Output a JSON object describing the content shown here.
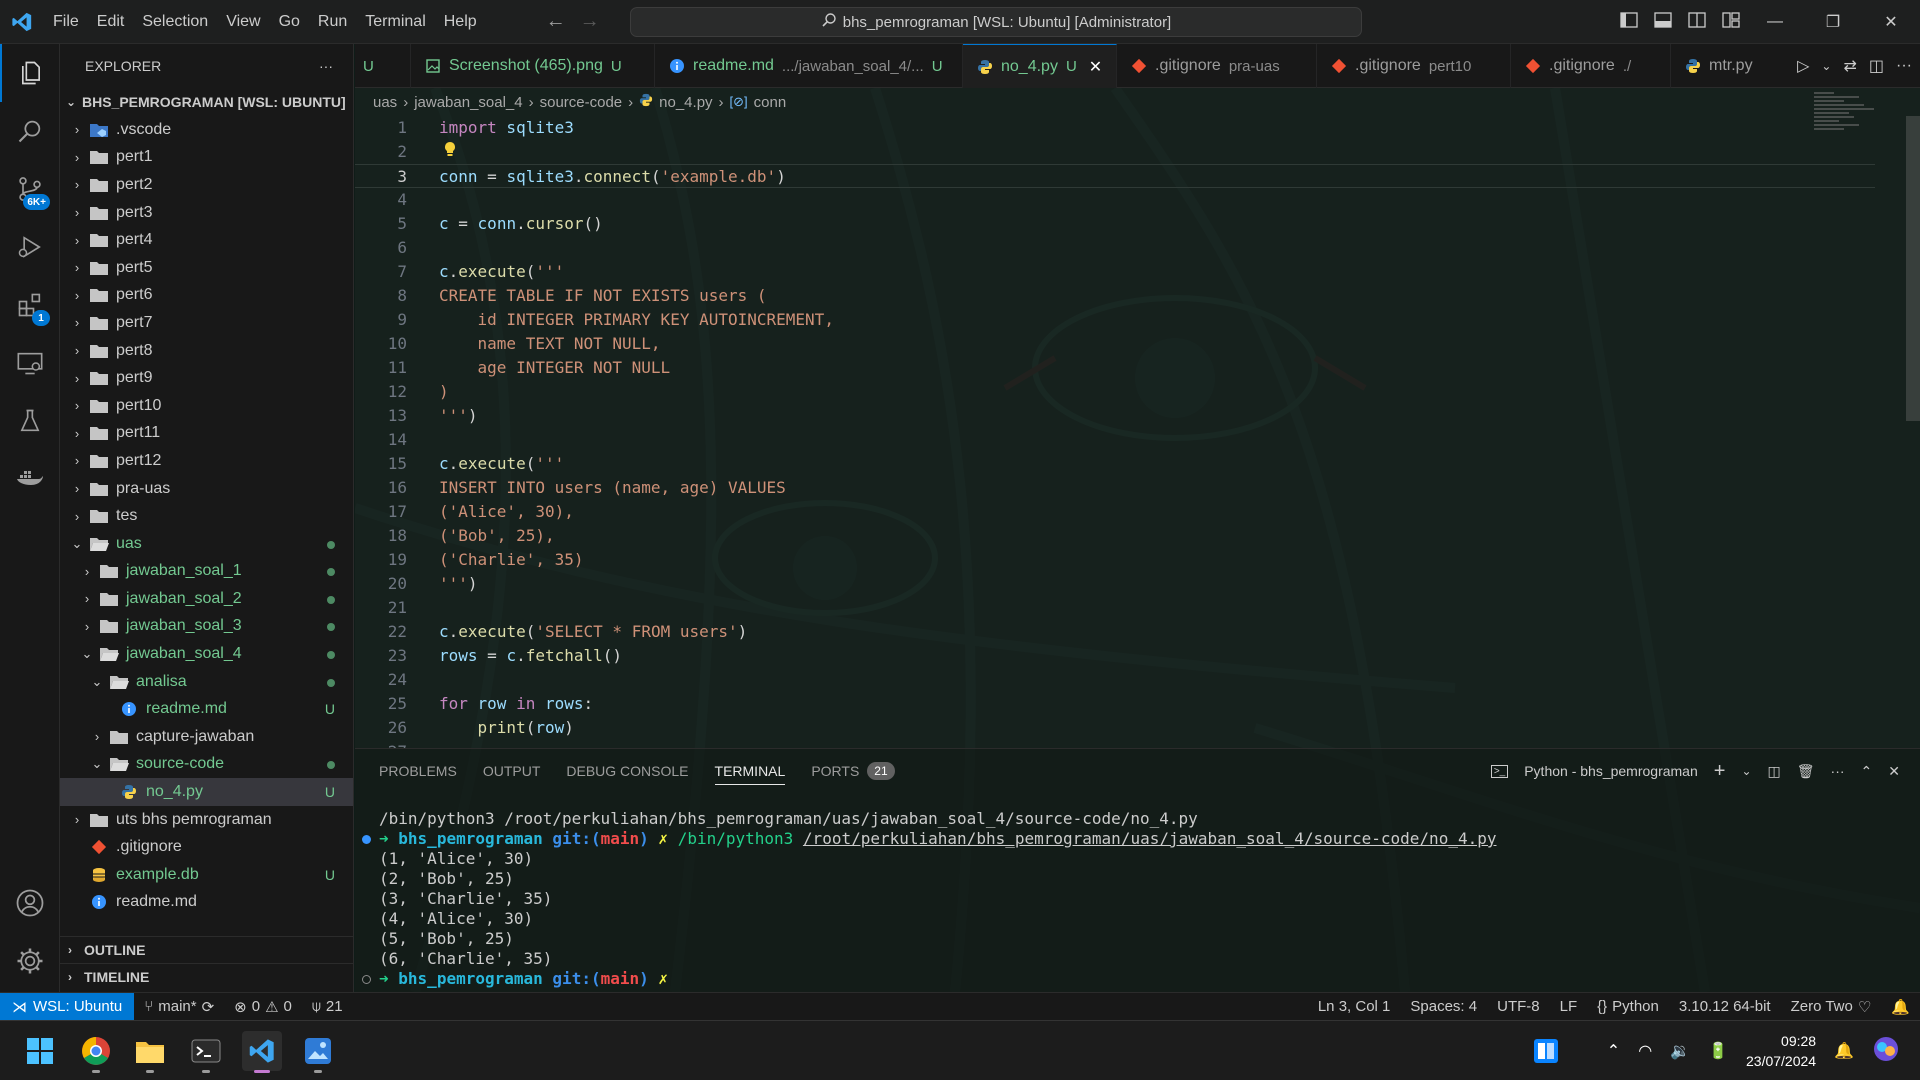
{
  "titlebar": {
    "menu": [
      "File",
      "Edit",
      "Selection",
      "View",
      "Go",
      "Run",
      "Terminal",
      "Help"
    ],
    "command_center": "bhs_pemrograman [WSL: Ubuntu] [Administrator]"
  },
  "activity": {
    "scm_badge": "6K+",
    "extensions_badge": "1"
  },
  "explorer": {
    "title": "EXPLORER",
    "more": "···",
    "root": "BHS_PEMROGRAMAN [WSL: UBUNTU]",
    "items": [
      {
        "label": ".vscode"
      },
      {
        "label": "pert1"
      },
      {
        "label": "pert2"
      },
      {
        "label": "pert3"
      },
      {
        "label": "pert4"
      },
      {
        "label": "pert5"
      },
      {
        "label": "pert6"
      },
      {
        "label": "pert7"
      },
      {
        "label": "pert8"
      },
      {
        "label": "pert9"
      },
      {
        "label": "pert10"
      },
      {
        "label": "pert11"
      },
      {
        "label": "pert12"
      },
      {
        "label": "pra-uas"
      },
      {
        "label": "tes"
      },
      {
        "label": "uas"
      },
      {
        "label": "jawaban_soal_1"
      },
      {
        "label": "jawaban_soal_2"
      },
      {
        "label": "jawaban_soal_3"
      },
      {
        "label": "jawaban_soal_4"
      },
      {
        "label": "analisa"
      },
      {
        "label": "readme.md",
        "status": "U"
      },
      {
        "label": "capture-jawaban"
      },
      {
        "label": "source-code"
      },
      {
        "label": "no_4.py",
        "status": "U"
      },
      {
        "label": "uts bhs pemrograman"
      },
      {
        "label": ".gitignore"
      },
      {
        "label": "example.db",
        "status": "U"
      },
      {
        "label": "readme.md"
      }
    ],
    "outline": "OUTLINE",
    "timeline": "TIMELINE"
  },
  "tabs": [
    {
      "label": "",
      "desc": "",
      "status": "U"
    },
    {
      "label": "Screenshot (465).png",
      "desc": "",
      "status": "U"
    },
    {
      "label": "readme.md",
      "desc": ".../jawaban_soal_4/...",
      "status": "U"
    },
    {
      "label": "no_4.py",
      "desc": "",
      "status": "U"
    },
    {
      "label": ".gitignore",
      "desc": "pra-uas",
      "status": ""
    },
    {
      "label": ".gitignore",
      "desc": "pert10",
      "status": ""
    },
    {
      "label": ".gitignore",
      "desc": "./",
      "status": ""
    },
    {
      "label": "mtr.py",
      "desc": "",
      "status": ""
    }
  ],
  "breadcrumb": [
    "uas",
    "jawaban_soal_4",
    "source-code",
    "no_4.py",
    "conn"
  ],
  "code": {
    "line_numbers": [
      "1",
      "2",
      "3",
      "4",
      "5",
      "6",
      "7",
      "8",
      "9",
      "10",
      "11",
      "12",
      "13",
      "14",
      "15",
      "16",
      "17",
      "18",
      "19",
      "20",
      "21",
      "22",
      "23",
      "24",
      "25",
      "26",
      "27"
    ],
    "l1_kw": "import",
    "l1_mod": " sqlite3",
    "l3_var": "conn",
    "l3_eq": " = ",
    "l3_mod": "sqlite3",
    "l3_dot": ".",
    "l3_fn": "connect",
    "l3_p1": "(",
    "l3_str": "'example.db'",
    "l3_p2": ")",
    "l5_var": "c",
    "l5_eq": " = ",
    "l5_obj": "conn",
    "l5_dot": ".",
    "l5_fn": "cursor",
    "l5_p": "()",
    "l7_var": "c",
    "l7_dot": ".",
    "l7_fn": "execute",
    "l7_p": "(",
    "l7_str": "'''",
    "l8": "CREATE TABLE IF NOT EXISTS users (",
    "l9": "    id INTEGER PRIMARY KEY AUTOINCREMENT,",
    "l10": "    name TEXT NOT NULL,",
    "l11": "    age INTEGER NOT NULL",
    "l12": ")",
    "l13_str": "'''",
    "l13_p": ")",
    "l15_var": "c",
    "l15_dot": ".",
    "l15_fn": "execute",
    "l15_p": "(",
    "l15_str": "'''",
    "l16": "INSERT INTO users (name, age) VALUES",
    "l17": "('Alice', 30),",
    "l18": "('Bob', 25),",
    "l19": "('Charlie', 35)",
    "l20_str": "'''",
    "l20_p": ")",
    "l22_var": "c",
    "l22_dot": ".",
    "l22_fn": "execute",
    "l22_p1": "(",
    "l22_str": "'SELECT * FROM users'",
    "l22_p2": ")",
    "l23_var": "rows",
    "l23_eq": " = ",
    "l23_obj": "c",
    "l23_dot": ".",
    "l23_fn": "fetchall",
    "l23_p": "()",
    "l25_for": "for",
    "l25_row": " row ",
    "l25_in": "in",
    "l25_rows": " rows",
    "l25_colon": ":",
    "l26_indent": "    ",
    "l26_fn": "print",
    "l26_p1": "(",
    "l26_var": "row",
    "l26_p2": ")"
  },
  "panel": {
    "tabs": [
      "PROBLEMS",
      "OUTPUT",
      "DEBUG CONSOLE",
      "TERMINAL",
      "PORTS"
    ],
    "ports_badge": "21",
    "terminal_name": "Python - bhs_pemrograman"
  },
  "terminal": {
    "line0": "/bin/python3 /root/perkuliahan/bhs_pemrograman/uas/jawaban_soal_4/source-code/no_4.py",
    "arrow": "➜",
    "dir": "bhs_pemrograman",
    "git_label": "git:(",
    "branch": "main",
    "git_close": ")",
    "x_mark": "✗",
    "cmd": "/bin/python3",
    "path": "/root/perkuliahan/bhs_pemrograman/uas/jawaban_soal_4/source-code/no_4.py",
    "outputs": [
      "(1, 'Alice', 30)",
      "(2, 'Bob', 25)",
      "(3, 'Charlie', 35)",
      "(4, 'Alice', 30)",
      "(5, 'Bob', 25)",
      "(6, 'Charlie', 35)"
    ]
  },
  "statusbar": {
    "remote": "WSL: Ubuntu",
    "branch": "main*",
    "errors": "0",
    "warnings": "0",
    "ports": "21",
    "position": "Ln 3, Col 1",
    "spaces": "Spaces: 4",
    "encoding": "UTF-8",
    "eol": "LF",
    "language": "Python",
    "interpreter": "3.10.12 64-bit",
    "theme": "Zero Two"
  },
  "taskbar": {
    "time": "09:28",
    "date": "23/07/2024"
  },
  "colors": {
    "accent": "#0078d4",
    "git_untracked": "#73c991",
    "background_tint": "#0f1c18"
  }
}
